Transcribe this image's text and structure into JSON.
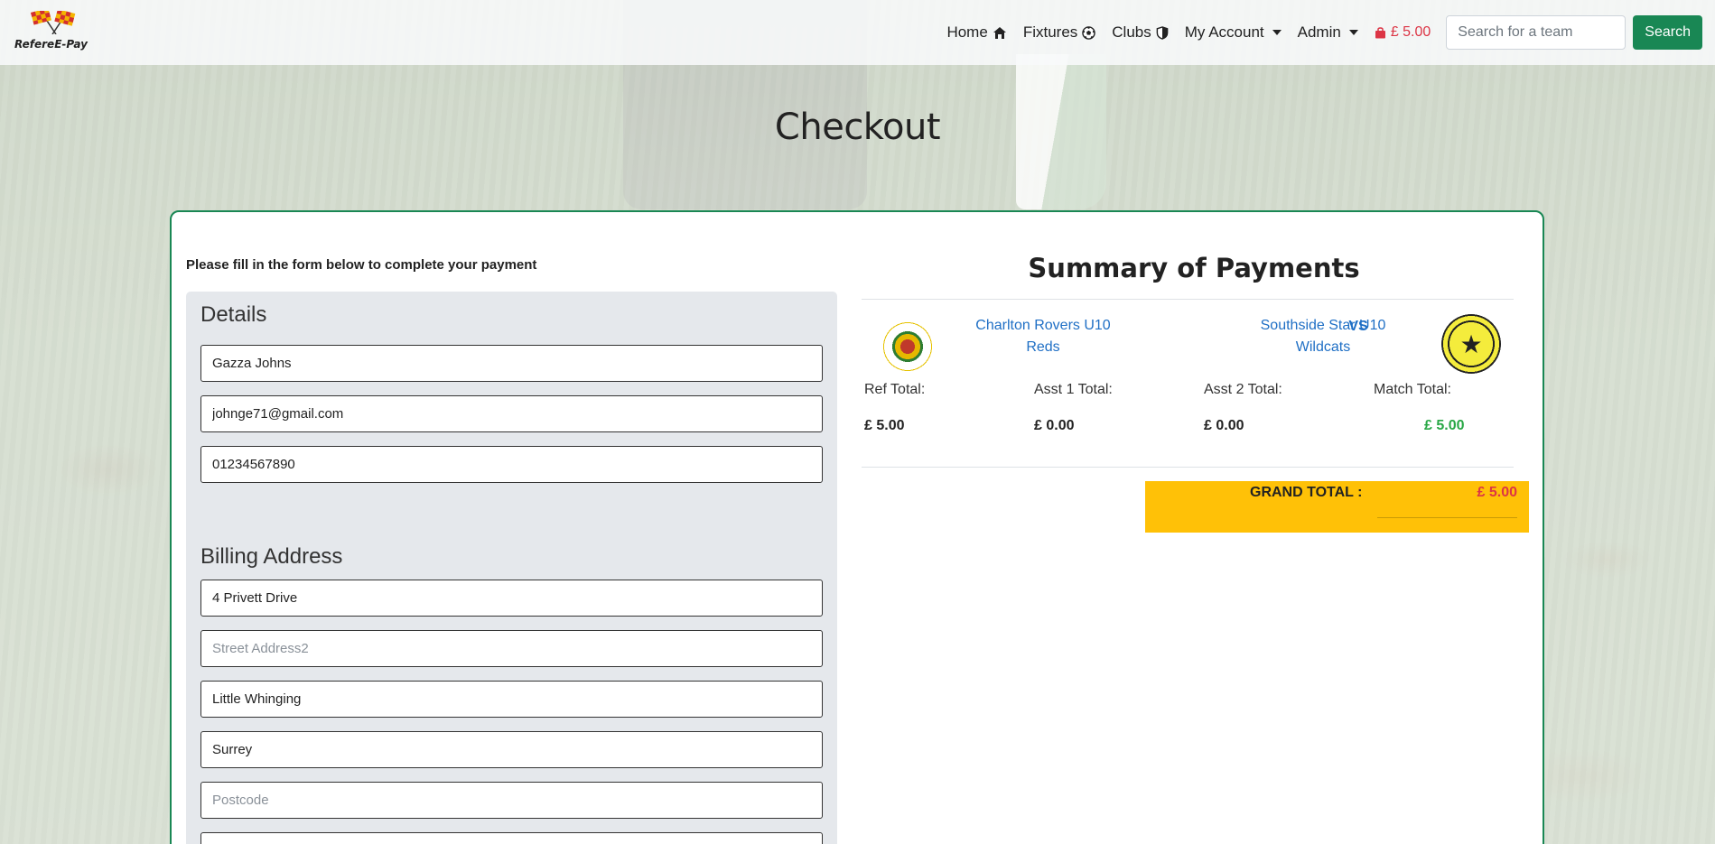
{
  "nav": {
    "brand": "RefereE-Pay",
    "home": "Home",
    "fixtures": "Fixtures",
    "clubs": "Clubs",
    "my_account": "My Account",
    "admin": "Admin",
    "cart_total": "£ 5.00",
    "search_placeholder": "Search for a team",
    "search_button": "Search"
  },
  "page_title": "Checkout",
  "form": {
    "instructions": "Please fill in the form below to complete your payment",
    "details_heading": "Details",
    "name_value": "Gazza Johns",
    "email_value": "johnge71@gmail.com",
    "phone_value": "01234567890",
    "billing_heading": "Billing Address",
    "street1_value": "4 Privett Drive",
    "street2_placeholder": "Street Address2",
    "town_value": "Little Whinging",
    "county_value": "Surrey",
    "postcode_placeholder": "Postcode"
  },
  "summary": {
    "title": "Summary of Payments",
    "home_team": "Charlton Rovers U10 Reds",
    "vs": "VS",
    "away_team": "Southside Star U10 Wildcats",
    "ref_total_label": "Ref Total:",
    "asst1_total_label": "Asst 1 Total:",
    "asst2_total_label": "Asst 2 Total:",
    "match_total_label": "Match Total:",
    "ref_total": "£ 5.00",
    "asst1_total": "£ 0.00",
    "asst2_total": "£ 0.00",
    "match_total": "£ 5.00",
    "grand_total_label": "GRAND TOTAL :",
    "grand_total": "£ 5.00"
  },
  "icons": {
    "home": "house-icon",
    "fixtures": "football-icon",
    "clubs": "shield-icon",
    "cart": "shopping-bag-icon"
  },
  "colors": {
    "accent": "#198754",
    "link": "#1f6fc5",
    "danger": "#dc3545",
    "grand_total_bg": "#ffc107"
  }
}
